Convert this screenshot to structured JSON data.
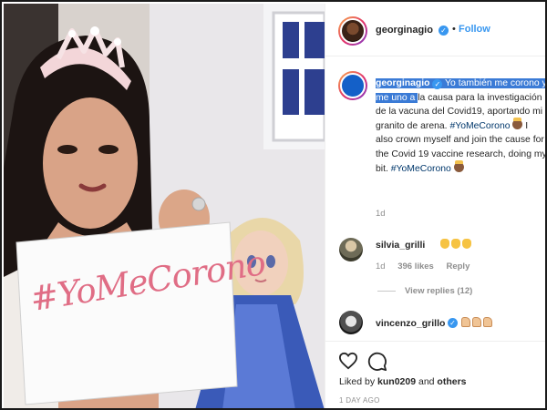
{
  "post": {
    "author": "georginagio",
    "follow_label": "Follow",
    "dot": "•",
    "verified_glyph": "✓"
  },
  "photo": {
    "sign_text": "#YoMeCorono"
  },
  "caption": {
    "user": "georginagio",
    "highlighted_text": " Yo también me corono y me uno a ",
    "text": "la causa para la investigación de la vacuna del Covid19, aportando mi granito de arena. ",
    "hashtag1": "#YoMeCorono",
    "text_en": " I also crown myself and join the cause for the Covid 19 vaccine research, doing my bit. ",
    "hashtag2": "#YoMeCorono",
    "time": "1d"
  },
  "comments": [
    {
      "user": "silvia_grilli",
      "time": "1d",
      "likes": "396 likes",
      "reply": "Reply",
      "view_replies": "View replies (12)"
    },
    {
      "user": "vincenzo_grillo"
    }
  ],
  "footer": {
    "liked_by_prefix": "Liked by ",
    "liked_by_user": "kun0209",
    "liked_by_and": " and ",
    "liked_by_others": "others",
    "date": "1 DAY AGO"
  },
  "icons": [
    "heart-icon",
    "comment-icon",
    "verified-badge-icon",
    "more-options-icon"
  ],
  "colors": {
    "link_blue": "#3897f0",
    "highlight": "#3b7bd6",
    "hashtag": "#00376b",
    "muted": "#8e8e8e",
    "sign_ink": "#e06d85"
  }
}
